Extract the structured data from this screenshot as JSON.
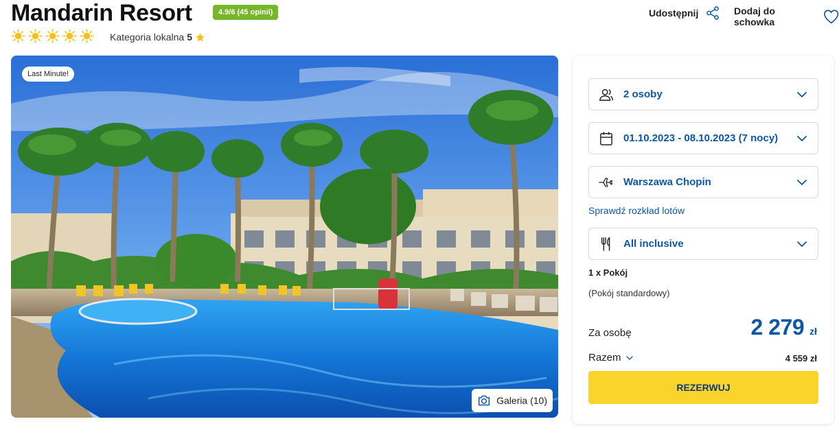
{
  "hotel": {
    "name": "Mandarin Resort",
    "rating_badge": "4.9/6 (45 opinii)",
    "suns": 5,
    "category_label": "Kategoria lokalna",
    "category_value": "5"
  },
  "actions": {
    "share_label": "Udostępnij",
    "favorite_label": "Dodaj do schowka"
  },
  "photo": {
    "badge": "Last Minute!",
    "gallery_label": "Galeria (10)"
  },
  "booking": {
    "persons": "2 osoby",
    "dates": "01.10.2023 - 08.10.2023 (7 nocy)",
    "airport": "Warszawa Chopin",
    "flight_schedule_link": "Sprawdź rozkład lotów",
    "board": "All inclusive",
    "room_count": "1 x Pokój",
    "room_type": "(Pokój standardowy)",
    "per_person_label": "Za osobę",
    "per_person_price": "2 279",
    "currency": "zł",
    "total_label": "Razem",
    "total_value": "4 559 zł",
    "book_button": "REZERWUJ"
  },
  "colors": {
    "accent": "#0a58a6",
    "rating_green": "#76b72a",
    "button_yellow": "#fbd42b",
    "sun": "#f6c21a"
  }
}
